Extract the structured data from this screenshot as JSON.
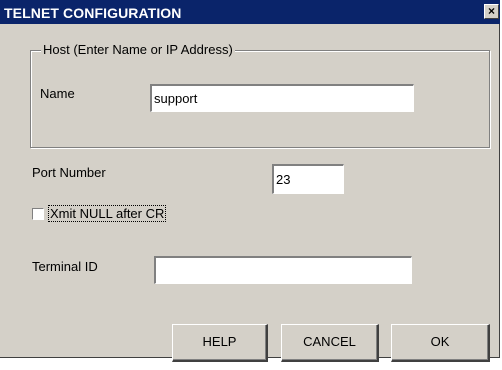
{
  "dialog": {
    "title": "TELNET CONFIGURATION",
    "close_glyph": "×"
  },
  "host_group": {
    "legend": "Host (Enter Name or IP Address)",
    "name_label": "Name",
    "name_value": "support"
  },
  "port": {
    "label": "Port Number",
    "value": "23"
  },
  "xmit_null": {
    "label": "Xmit NULL after CR",
    "checked": false
  },
  "terminal": {
    "label": "Terminal ID",
    "value": ""
  },
  "buttons": {
    "help": "HELP",
    "cancel": "CANCEL",
    "ok": "OK"
  },
  "colors": {
    "title_bar": "#0a246a",
    "dialog_face": "#d4d0c8"
  }
}
